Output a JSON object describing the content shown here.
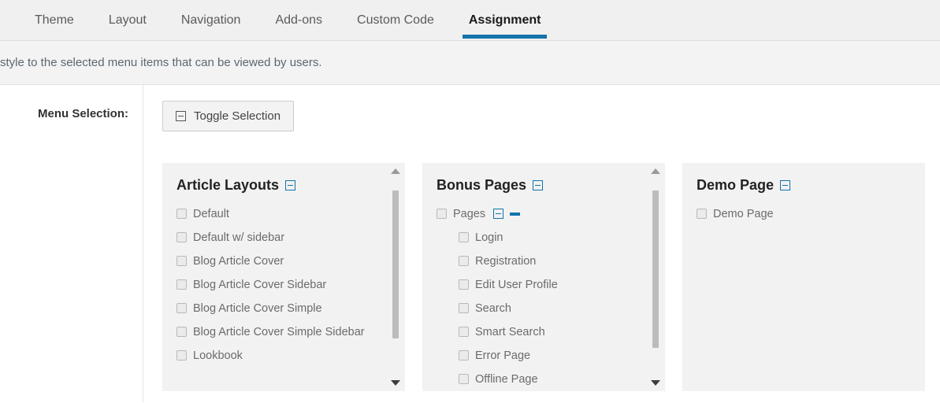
{
  "tabs": [
    {
      "label": "Theme",
      "active": false
    },
    {
      "label": "Layout",
      "active": false
    },
    {
      "label": "Navigation",
      "active": false
    },
    {
      "label": "Add-ons",
      "active": false
    },
    {
      "label": "Custom Code",
      "active": false
    },
    {
      "label": "Assignment",
      "active": true
    }
  ],
  "description": {
    "text": "style to the selected menu items that can be viewed by users."
  },
  "form": {
    "menu_selection_label": "Menu Selection:",
    "toggle_button_label": "Toggle Selection",
    "toggle_button_icon": "minus-square-icon"
  },
  "colors": {
    "accent_blue": "#1274ab",
    "panel_bg": "#f2f2f2",
    "tabbar_bg": "#f0f0f0",
    "desc_bg": "#f3f3f3",
    "scrollbar_thumb": "#bcbcbc"
  },
  "panels": [
    {
      "title": "Article Layouts",
      "title_icon": "minus-square-icon",
      "has_scrollbar": true,
      "items": [
        {
          "label": "Default",
          "checked": false,
          "indent": false
        },
        {
          "label": "Default w/ sidebar",
          "checked": false,
          "indent": false
        },
        {
          "label": "Blog Article Cover",
          "checked": false,
          "indent": false
        },
        {
          "label": "Blog Article Cover Sidebar",
          "checked": false,
          "indent": false
        },
        {
          "label": "Blog Article Cover Simple",
          "checked": false,
          "indent": false
        },
        {
          "label": "Blog Article Cover Simple Sidebar",
          "checked": false,
          "indent": false
        },
        {
          "label": "Lookbook",
          "checked": false,
          "indent": false
        }
      ]
    },
    {
      "title": "Bonus Pages",
      "title_icon": "minus-square-icon",
      "has_scrollbar": true,
      "items": [
        {
          "label": "Pages",
          "checked": false,
          "indent": false,
          "icons": [
            "minus-square-icon",
            "dash-icon"
          ]
        },
        {
          "label": "Login",
          "checked": false,
          "indent": true
        },
        {
          "label": "Registration",
          "checked": false,
          "indent": true
        },
        {
          "label": "Edit User Profile",
          "checked": false,
          "indent": true
        },
        {
          "label": "Search",
          "checked": false,
          "indent": true
        },
        {
          "label": "Smart Search",
          "checked": false,
          "indent": true
        },
        {
          "label": "Error Page",
          "checked": false,
          "indent": true
        },
        {
          "label": "Offline Page",
          "checked": false,
          "indent": true
        }
      ]
    },
    {
      "title": "Demo Page",
      "title_icon": "minus-square-icon",
      "has_scrollbar": false,
      "items": [
        {
          "label": "Demo Page",
          "checked": false,
          "indent": false
        }
      ]
    }
  ]
}
